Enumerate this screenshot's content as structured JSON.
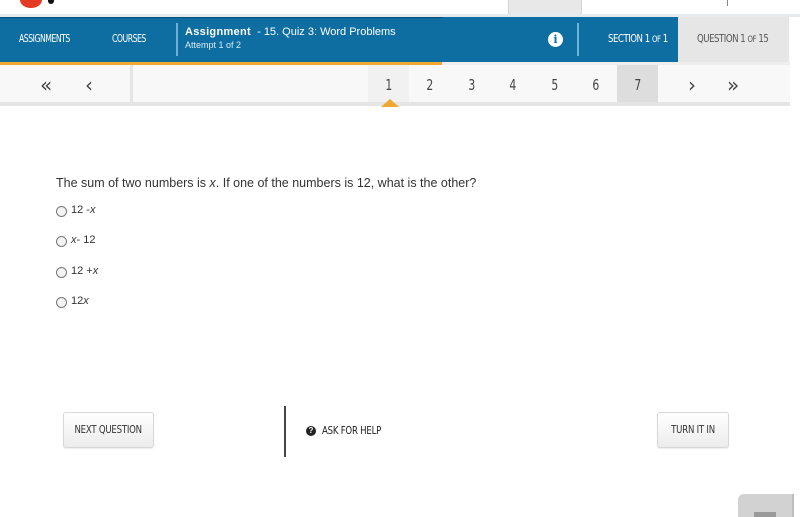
{
  "header": {
    "nav": [
      {
        "label": "ASSIGNMENTS"
      },
      {
        "label": "COURSES"
      }
    ],
    "assignment": {
      "title": "Assignment",
      "name": "- 15. Quiz 3: Word Problems",
      "attempt": "Attempt 1 of 2"
    },
    "info_icon": "info-icon",
    "section": {
      "prefix": "SECTION 1",
      "of": "OF",
      "total": "1"
    },
    "question": {
      "prefix": "QUESTION 1",
      "of": "OF",
      "total": "15"
    }
  },
  "progress": {
    "fraction": 0.56,
    "color": "#f0a830"
  },
  "pager": {
    "first_icon": "«",
    "prev_icon": "‹",
    "next_icon": "›",
    "last_icon": "»",
    "pages": [
      "1",
      "2",
      "3",
      "4",
      "5",
      "6",
      "7"
    ],
    "current_page": "1",
    "visited_page": "7"
  },
  "question": {
    "text_before": "The sum of two numbers is ",
    "variable": "x",
    "text_after": ". If one of the numbers is 12, what is the other?",
    "options": [
      {
        "pre": "12 - ",
        "var": "x",
        "post": ""
      },
      {
        "pre": "",
        "var": "x",
        "post": " - 12"
      },
      {
        "pre": "12 + ",
        "var": "x",
        "post": ""
      },
      {
        "pre": "12 ",
        "var": "x",
        "post": ""
      }
    ]
  },
  "footer": {
    "next_label": "NEXT QUESTION",
    "help_label": "ASK FOR HELP",
    "help_icon": "?",
    "turn_in_label": "TURN IT IN"
  },
  "colors": {
    "header_blue": "#0f6ea1",
    "accent_orange": "#f0a830"
  }
}
